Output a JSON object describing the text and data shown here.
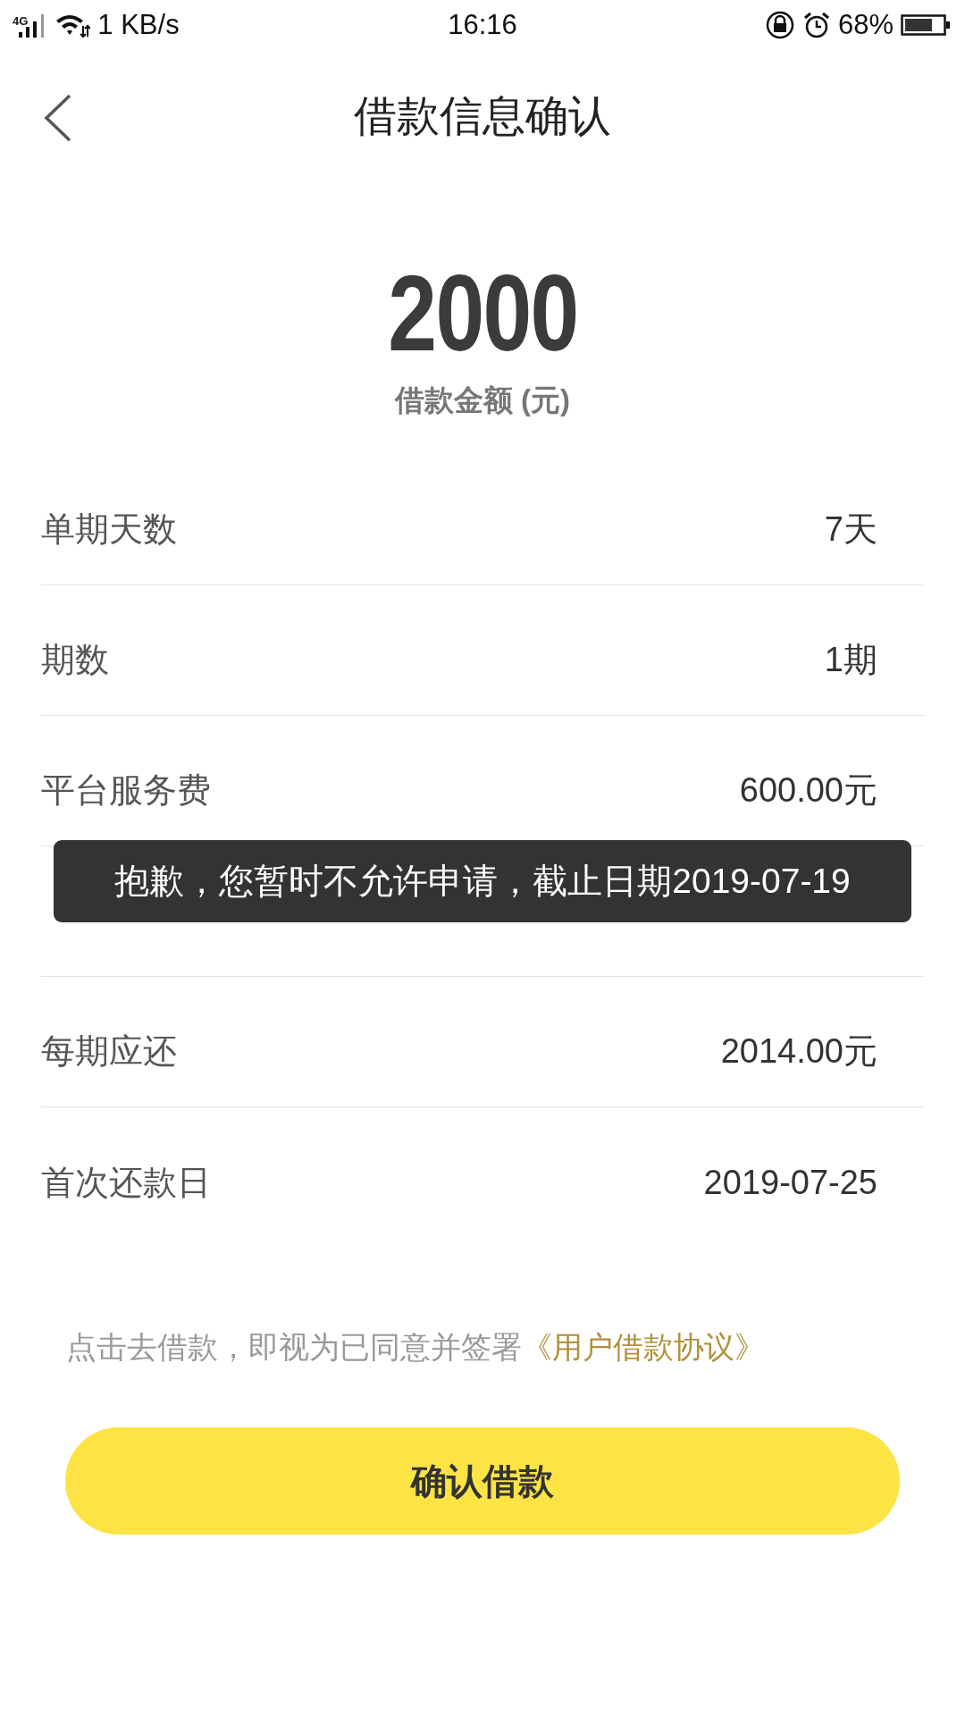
{
  "status_bar": {
    "network": "4G",
    "speed": "1 KB/s",
    "time": "16:16",
    "battery": "68%"
  },
  "header": {
    "title": "借款信息确认"
  },
  "amount": {
    "value": "2000",
    "label": "借款金额 (元)"
  },
  "rows": [
    {
      "kind": "text",
      "label": "单期天数",
      "value": "7天"
    },
    {
      "kind": "text",
      "label": "期数",
      "value": "1期"
    },
    {
      "kind": "text",
      "label": "平台服务费",
      "value": "600.00元"
    },
    {
      "kind": "covered"
    },
    {
      "kind": "text",
      "label": "每期应还",
      "value": "2014.00元"
    },
    {
      "kind": "text",
      "label": "首次还款日",
      "value": "2019-07-25"
    }
  ],
  "toast": {
    "text": "抱歉，您暂时不允许申请，截止日期2019-07-19"
  },
  "agreement": {
    "text": "点击去借款，即视为已同意并签署",
    "link": "《用户借款协议》"
  },
  "confirm_button": {
    "label": "确认借款"
  }
}
